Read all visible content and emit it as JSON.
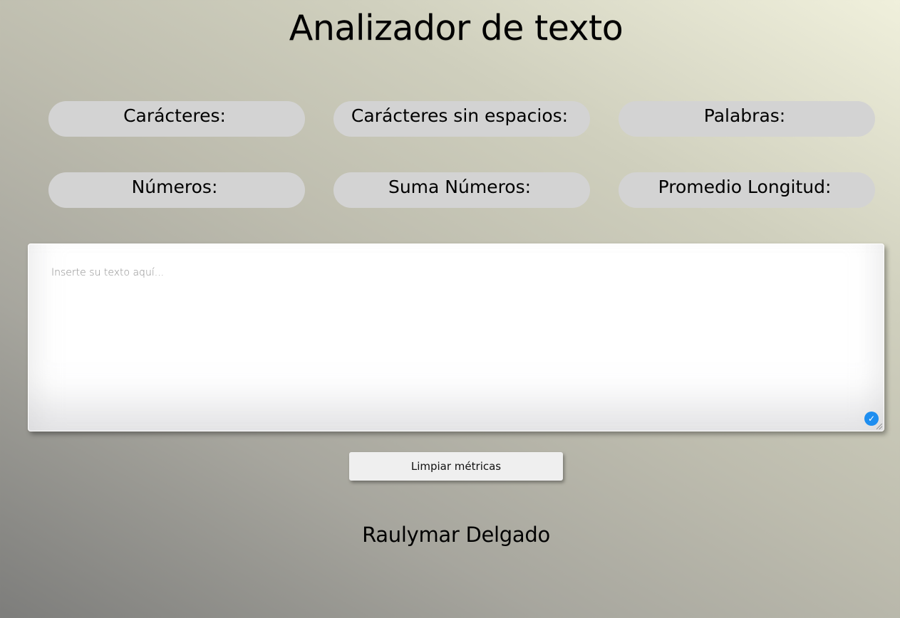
{
  "page_title": "Analizador de texto",
  "metrics": [
    {
      "label": "Carácteres:",
      "value": ""
    },
    {
      "label": "Carácteres sin espacios:",
      "value": ""
    },
    {
      "label": "Palabras:",
      "value": ""
    },
    {
      "label": "Números:",
      "value": ""
    },
    {
      "label": "Suma Números:",
      "value": ""
    },
    {
      "label": "Promedio Longitud:",
      "value": ""
    }
  ],
  "text_input": {
    "value": "",
    "placeholder": "Inserte su texto aquí..."
  },
  "clear_button_label": "Limpiar métricas",
  "author": "Raulymar Delgado",
  "icons": {
    "validation": "checkmark-circle-icon",
    "resize": "resize-grip-icon"
  },
  "colors": {
    "pill_background": "#d3d3d3",
    "check_badge": "#1e8ef0",
    "button_background": "#efefef"
  }
}
